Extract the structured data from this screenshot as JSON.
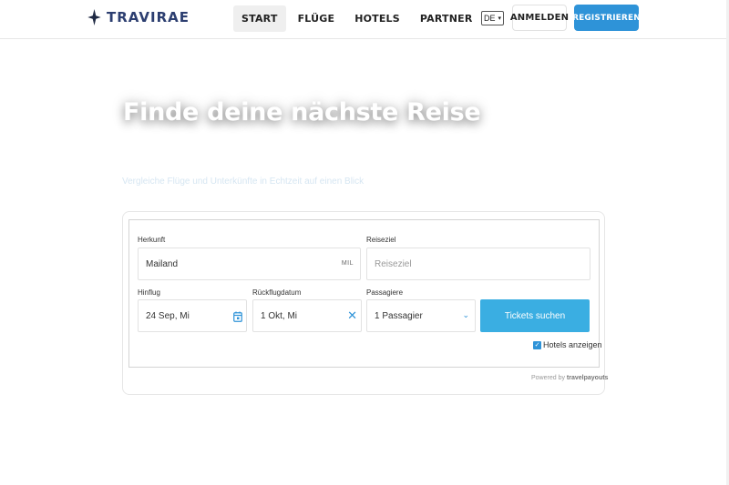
{
  "brand": {
    "name": "TRAVIRAE",
    "icon": "sparkle-icon",
    "color": "#2c3e70"
  },
  "nav": {
    "items": [
      {
        "label": "START",
        "active": true
      },
      {
        "label": "FLÜGE",
        "active": false
      },
      {
        "label": "HOTELS",
        "active": false
      },
      {
        "label": "PARTNER",
        "active": false
      }
    ]
  },
  "language": {
    "selected": "DE"
  },
  "auth": {
    "login_label": "ANMELDEN",
    "register_label": "REGISTRIEREN",
    "accent": "#2e93d8"
  },
  "hero": {
    "title": "Finde deine nächste Reise",
    "subtitle": "Vergleiche Flüge und Unterkünfte in Echtzeit auf einen Blick"
  },
  "search": {
    "origin": {
      "label": "Herkunft",
      "value": "Mailand",
      "code": "MIL"
    },
    "destination": {
      "label": "Reiseziel",
      "placeholder": "Reiseziel"
    },
    "departure": {
      "label": "Hinflug",
      "value": "24 Sep, Mi"
    },
    "return": {
      "label": "Rückflugdatum",
      "value": "1 Okt, Mi"
    },
    "passengers": {
      "label": "Passagiere",
      "value": "1 Passagier"
    },
    "submit_label": "Tickets suchen",
    "submit_color": "#3aaee2",
    "hotels_checkbox": {
      "label": "Hotels anzeigen",
      "checked": true
    },
    "powered_by_prefix": "Powered by",
    "powered_by_brand": "travelpayouts"
  }
}
